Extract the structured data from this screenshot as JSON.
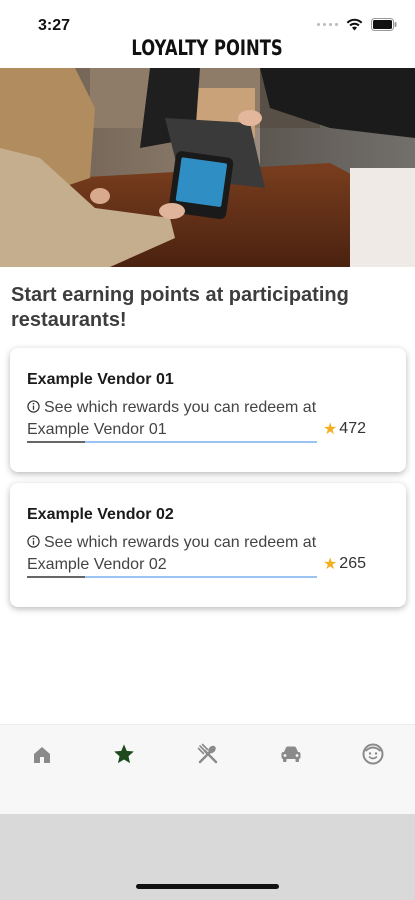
{
  "status_bar": {
    "time": "3:27",
    "icons": [
      "signal-dots-icon",
      "wifi-icon",
      "battery-icon"
    ]
  },
  "header": {
    "title": "LOYALTY POINTS"
  },
  "hero": {
    "image": "photo of a customer paying at a restaurant counter with a tablet"
  },
  "intro": {
    "text": "Start earning points at participating restaurants!"
  },
  "vendors": [
    {
      "name": "Example Vendor 01",
      "description": "See which rewards you can redeem at Example Vendor 01",
      "points": "472",
      "progress": 0.2
    },
    {
      "name": "Example Vendor 02",
      "description": "See which rewards you can redeem at Example Vendor 02",
      "points": "265",
      "progress": 0.2
    }
  ],
  "tabs": [
    {
      "icon": "home-icon",
      "active": false
    },
    {
      "icon": "star-icon",
      "active": true
    },
    {
      "icon": "utensils-icon",
      "active": false
    },
    {
      "icon": "car-icon",
      "active": false
    },
    {
      "icon": "smiley-icon",
      "active": false
    }
  ],
  "colors": {
    "active_tab": "#1e4a1e",
    "inactive_tab": "#8a8a8a",
    "star": "#f2b01e",
    "progress_track": "#9cc4f2",
    "progress_fill": "#666666"
  }
}
